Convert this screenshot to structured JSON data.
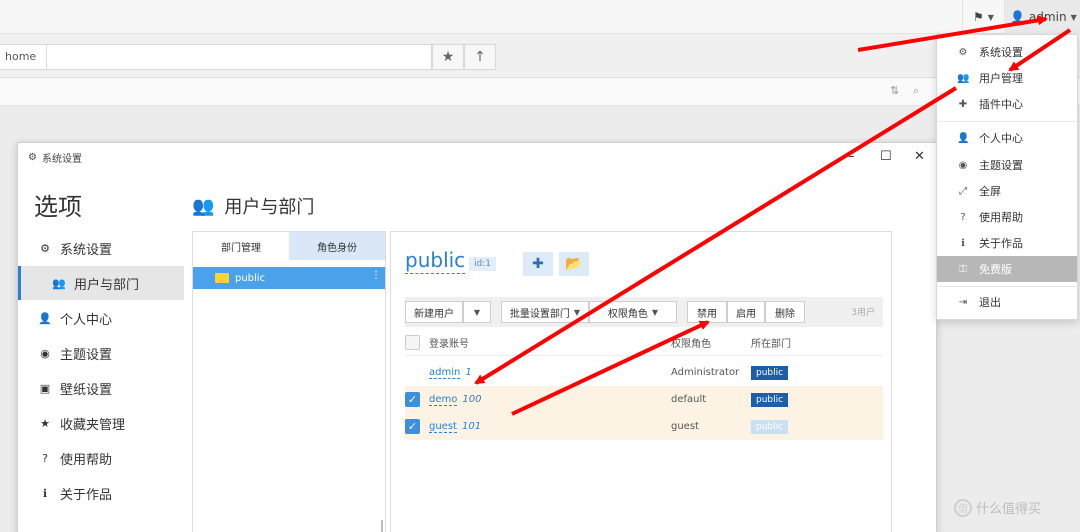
{
  "topbar": {
    "flag_icon": "flag-icon",
    "user_name": "admin"
  },
  "address": {
    "crumb": "home"
  },
  "window": {
    "title": "系统设置",
    "options_title": "选项",
    "nav": [
      {
        "label": "系统设置",
        "icon": "gear-icon"
      },
      {
        "label": "用户与部门",
        "icon": "users-icon"
      },
      {
        "label": "个人中心",
        "icon": "user-icon"
      },
      {
        "label": "主题设置",
        "icon": "dashboard-icon"
      },
      {
        "label": "壁纸设置",
        "icon": "image-icon"
      },
      {
        "label": "收藏夹管理",
        "icon": "star-icon"
      },
      {
        "label": "使用帮助",
        "icon": "question-icon"
      },
      {
        "label": "关于作品",
        "icon": "info-icon"
      }
    ],
    "main_heading": "用户与部门",
    "dept_tabs": [
      "部门管理",
      "角色身份"
    ],
    "dept_selected": "public",
    "group": {
      "name": "public",
      "id": "id:1"
    },
    "toolbar": {
      "new_user": "新建用户",
      "batch_dept": "批量设置部门",
      "perm_role": "权限角色",
      "disable": "禁用",
      "enable": "启用",
      "delete": "删除",
      "count": "3用户"
    },
    "columns": {
      "account": "登录账号",
      "role": "权限角色",
      "dept": "所在部门"
    },
    "users": [
      {
        "name": "admin",
        "id": "1",
        "role": "Administrator",
        "dept": "public",
        "checked": false
      },
      {
        "name": "demo",
        "id": "100",
        "role": "default",
        "dept": "public",
        "checked": true
      },
      {
        "name": "guest",
        "id": "101",
        "role": "guest",
        "dept": "public",
        "checked": true
      }
    ]
  },
  "menu": {
    "items": [
      {
        "label": "系统设置",
        "icon": "gear-icon"
      },
      {
        "label": "用户管理",
        "icon": "users-icon"
      },
      {
        "label": "插件中心",
        "icon": "puzzle-icon"
      },
      {
        "label": "个人中心",
        "icon": "user-icon"
      },
      {
        "label": "主题设置",
        "icon": "dashboard-icon"
      },
      {
        "label": "全屏",
        "icon": "fullscreen-icon"
      },
      {
        "label": "使用帮助",
        "icon": "question-icon"
      },
      {
        "label": "关于作品",
        "icon": "info-icon"
      },
      {
        "label": "免费版",
        "icon": "key-icon"
      },
      {
        "label": "退出",
        "icon": "logout-icon"
      }
    ]
  },
  "watermark": "什么值得买",
  "colors": {
    "accent": "#2a7fd6",
    "selection": "#4aa3ea",
    "arrow": "#ff0000"
  }
}
